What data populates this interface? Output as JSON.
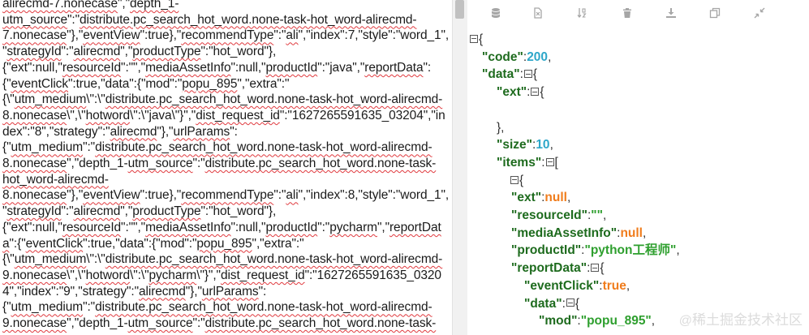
{
  "raw_text": {
    "lines": [
      [
        [
          "alirecmd-7.nonecase",
          1
        ],
        [
          "\",\"",
          0
        ],
        [
          "depth_1-",
          1
        ]
      ],
      [
        [
          "utm_source",
          1
        ],
        [
          "\":\"",
          0
        ],
        [
          "distribute.pc_search_hot_word.none-task-hot_word-alirecmd-",
          1
        ]
      ],
      [
        [
          "7.nonecase",
          1
        ],
        [
          "\"},\"",
          0
        ],
        [
          "eventView",
          1
        ],
        [
          "\":true},\"",
          0
        ],
        [
          "recommendType",
          1
        ],
        [
          "\":\"",
          0
        ],
        [
          "ali",
          1
        ],
        [
          "\",\"index\":7,\"style\":\"word_1\",",
          0
        ]
      ],
      [
        [
          "\"",
          0
        ],
        [
          "strategyId",
          1
        ],
        [
          "\":\"",
          0
        ],
        [
          "alirecmd",
          1
        ],
        [
          "\",\"",
          0
        ],
        [
          "productType",
          1
        ],
        [
          "\":\"hot_word\"},",
          0
        ]
      ],
      [
        [
          "{\"ext\":null,\"",
          0
        ],
        [
          "resourceId",
          1
        ],
        [
          "\":\"\",\"",
          0
        ],
        [
          "mediaAssetInfo",
          1
        ],
        [
          "\":null,\"",
          0
        ],
        [
          "productId",
          1
        ],
        [
          "\":\"java\",\"",
          0
        ],
        [
          "reportData",
          1
        ],
        [
          "\":",
          0
        ]
      ],
      [
        [
          "{\"",
          0
        ],
        [
          "eventClick",
          1
        ],
        [
          "\":true,\"data\":{\"mod\":\"",
          0
        ],
        [
          "popu_895",
          1
        ],
        [
          "\",\"extra\":\"",
          0
        ]
      ],
      [
        [
          "{\\\"",
          0
        ],
        [
          "utm_medium",
          1
        ],
        [
          "\\\":\\\"",
          0
        ],
        [
          "distribute.pc_search_hot_word.none-task-hot_word-alirecmd-",
          1
        ]
      ],
      [
        [
          "8.nonecase",
          1
        ],
        [
          "\\\",\\\"",
          0
        ],
        [
          "hotword",
          1
        ],
        [
          "\\\":\\\"java\\\"}\",\"",
          0
        ],
        [
          "dist_request_id",
          1
        ],
        [
          "\":\"1627265591635_03204\",\"in",
          0
        ]
      ],
      [
        [
          "dex\":\"8\",\"strategy\":\"",
          0
        ],
        [
          "alirecmd",
          1
        ],
        [
          "\"},\"",
          0
        ],
        [
          "urlParams",
          1
        ],
        [
          "\":",
          0
        ]
      ],
      [
        [
          "{\"",
          0
        ],
        [
          "utm_medium",
          1
        ],
        [
          "\":\"",
          0
        ],
        [
          "distribute.pc_search_hot_word.none-task-hot_word-alirecmd-",
          1
        ]
      ],
      [
        [
          "8.nonecase",
          1
        ],
        [
          "\",\"depth_1-",
          0
        ],
        [
          "utm_source",
          1
        ],
        [
          "\":\"",
          0
        ],
        [
          "distribute.pc_search_hot_word.none-task-",
          1
        ]
      ],
      [
        [
          "hot_word-alirecmd-",
          1
        ]
      ],
      [
        [
          "8.nonecase",
          1
        ],
        [
          "\"},\"",
          0
        ],
        [
          "eventView",
          1
        ],
        [
          "\":true},\"",
          0
        ],
        [
          "recommendType",
          1
        ],
        [
          "\":\"",
          0
        ],
        [
          "ali",
          1
        ],
        [
          "\",\"index\":8,\"style\":\"word_1\",",
          0
        ]
      ],
      [
        [
          "\"",
          0
        ],
        [
          "strategyId",
          1
        ],
        [
          "\":\"",
          0
        ],
        [
          "alirecmd",
          1
        ],
        [
          "\",\"",
          0
        ],
        [
          "productType",
          1
        ],
        [
          "\":\"hot_word\"},",
          0
        ]
      ],
      [
        [
          "{\"ext\":null,\"",
          0
        ],
        [
          "resourceId",
          1
        ],
        [
          "\":\"\",\"",
          0
        ],
        [
          "mediaAssetInfo",
          1
        ],
        [
          "\":null,\"",
          0
        ],
        [
          "productId",
          1
        ],
        [
          "\":\"",
          0
        ],
        [
          "pycharm",
          1
        ],
        [
          "\",\"",
          0
        ],
        [
          "reportDat",
          1
        ]
      ],
      [
        [
          "a",
          1
        ],
        [
          "\":{\"",
          0
        ],
        [
          "eventClick",
          1
        ],
        [
          "\":true,\"data\":{\"mod\":\"",
          0
        ],
        [
          "popu_895",
          1
        ],
        [
          "\",\"extra\":\"",
          0
        ]
      ],
      [
        [
          "{\\\"",
          0
        ],
        [
          "utm_medium",
          1
        ],
        [
          "\\\":\\\"",
          0
        ],
        [
          "distribute.pc_search_hot_word.none-task-hot_word-alirecmd-",
          1
        ]
      ],
      [
        [
          "9.nonecase",
          1
        ],
        [
          "\\\",\\\"",
          0
        ],
        [
          "hotword",
          1
        ],
        [
          "\\\":\\\"",
          0
        ],
        [
          "pycharm",
          1
        ],
        [
          "\\\"}\",\"",
          0
        ],
        [
          "dist_request_id",
          1
        ],
        [
          "\":\"1627265591635_0320",
          0
        ]
      ],
      [
        [
          "4\",\"index\":\"9\",\"strategy\":\"",
          0
        ],
        [
          "alirecmd",
          1
        ],
        [
          "\"},\"",
          0
        ],
        [
          "urlParams",
          1
        ],
        [
          "\":",
          0
        ]
      ],
      [
        [
          "{\"",
          0
        ],
        [
          "utm_medium",
          1
        ],
        [
          "\":\"",
          0
        ],
        [
          "distribute.pc_search_hot_word.none-task-hot_word-alirecmd-",
          1
        ]
      ],
      [
        [
          "9.nonecase",
          1
        ],
        [
          "\",\"depth_1-",
          0
        ],
        [
          "utm_source",
          1
        ],
        [
          "\":\"",
          0
        ],
        [
          "distribute.pc_search_hot_word.none-task-",
          1
        ]
      ]
    ]
  },
  "toolbar": {
    "buttons": [
      {
        "name": "database",
        "icon": "database-icon"
      },
      {
        "name": "format-file",
        "icon": "file-format-icon"
      },
      {
        "name": "sort",
        "icon": "sort-icon"
      },
      {
        "name": "delete",
        "icon": "trash-icon"
      },
      {
        "name": "download",
        "icon": "download-icon"
      },
      {
        "name": "copy",
        "icon": "copy-icon"
      },
      {
        "name": "collapse",
        "icon": "compress-icon"
      }
    ]
  },
  "json_tree": {
    "lines": [
      {
        "indent": 0,
        "toggle": true,
        "parts": [
          [
            "{",
            "p"
          ]
        ]
      },
      {
        "indent": 1,
        "parts": [
          [
            "\"code\"",
            "k"
          ],
          [
            ":",
            "p"
          ],
          [
            "200",
            "n"
          ],
          [
            ",",
            "p"
          ]
        ]
      },
      {
        "indent": 1,
        "toggle_after": true,
        "parts": [
          [
            "\"data\"",
            "k"
          ],
          [
            ":",
            "p"
          ],
          [
            "{",
            "p"
          ]
        ]
      },
      {
        "indent": 2,
        "toggle_after": true,
        "parts": [
          [
            "\"ext\"",
            "k"
          ],
          [
            ":",
            "p"
          ],
          [
            "{",
            "p"
          ]
        ]
      },
      {
        "indent": 2,
        "parts": []
      },
      {
        "indent": 2,
        "parts": [
          [
            "},",
            "p"
          ]
        ]
      },
      {
        "indent": 2,
        "parts": [
          [
            "\"size\"",
            "k"
          ],
          [
            ":",
            "p"
          ],
          [
            "10",
            "n"
          ],
          [
            ",",
            "p"
          ]
        ]
      },
      {
        "indent": 2,
        "toggle_after": true,
        "parts": [
          [
            "\"items\"",
            "k"
          ],
          [
            ":",
            "p"
          ],
          [
            "[",
            "p"
          ]
        ]
      },
      {
        "indent": 3,
        "toggle": true,
        "parts": [
          [
            "{",
            "p"
          ]
        ]
      },
      {
        "indent": 4,
        "parts": [
          [
            "\"ext\"",
            "k"
          ],
          [
            ":",
            "p"
          ],
          [
            "null",
            "nl"
          ],
          [
            ",",
            "p"
          ]
        ]
      },
      {
        "indent": 4,
        "parts": [
          [
            "\"resourceId\"",
            "k"
          ],
          [
            ":",
            "p"
          ],
          [
            "\"\"",
            "s"
          ],
          [
            ",",
            "p"
          ]
        ]
      },
      {
        "indent": 4,
        "parts": [
          [
            "\"mediaAssetInfo\"",
            "k"
          ],
          [
            ":",
            "p"
          ],
          [
            "null",
            "nl"
          ],
          [
            ",",
            "p"
          ]
        ]
      },
      {
        "indent": 4,
        "parts": [
          [
            "\"productId\"",
            "k"
          ],
          [
            ":",
            "p"
          ],
          [
            "\"python工程师\"",
            "s"
          ],
          [
            ",",
            "p"
          ]
        ]
      },
      {
        "indent": 4,
        "toggle_after": true,
        "parts": [
          [
            "\"reportData\"",
            "k"
          ],
          [
            ":",
            "p"
          ],
          [
            "{",
            "p"
          ]
        ]
      },
      {
        "indent": 5,
        "parts": [
          [
            "\"eventClick\"",
            "k"
          ],
          [
            ":",
            "p"
          ],
          [
            "true",
            "b"
          ],
          [
            ",",
            "p"
          ]
        ]
      },
      {
        "indent": 5,
        "toggle_after": true,
        "parts": [
          [
            "\"data\"",
            "k"
          ],
          [
            ":",
            "p"
          ],
          [
            "{",
            "p"
          ]
        ]
      },
      {
        "indent": 6,
        "parts": [
          [
            "\"mod\"",
            "k"
          ],
          [
            ":",
            "p"
          ],
          [
            "\"popu_895\"",
            "s"
          ],
          [
            ",",
            "p"
          ]
        ]
      }
    ]
  },
  "watermark": {
    "at": "@",
    "text": "稀土掘金技术社区"
  },
  "colors": {
    "key": "#1e6b1e",
    "number": "#2ea7c9",
    "string": "#2e9f2e",
    "null": "#f07c1c",
    "bool": "#f07c1c"
  }
}
